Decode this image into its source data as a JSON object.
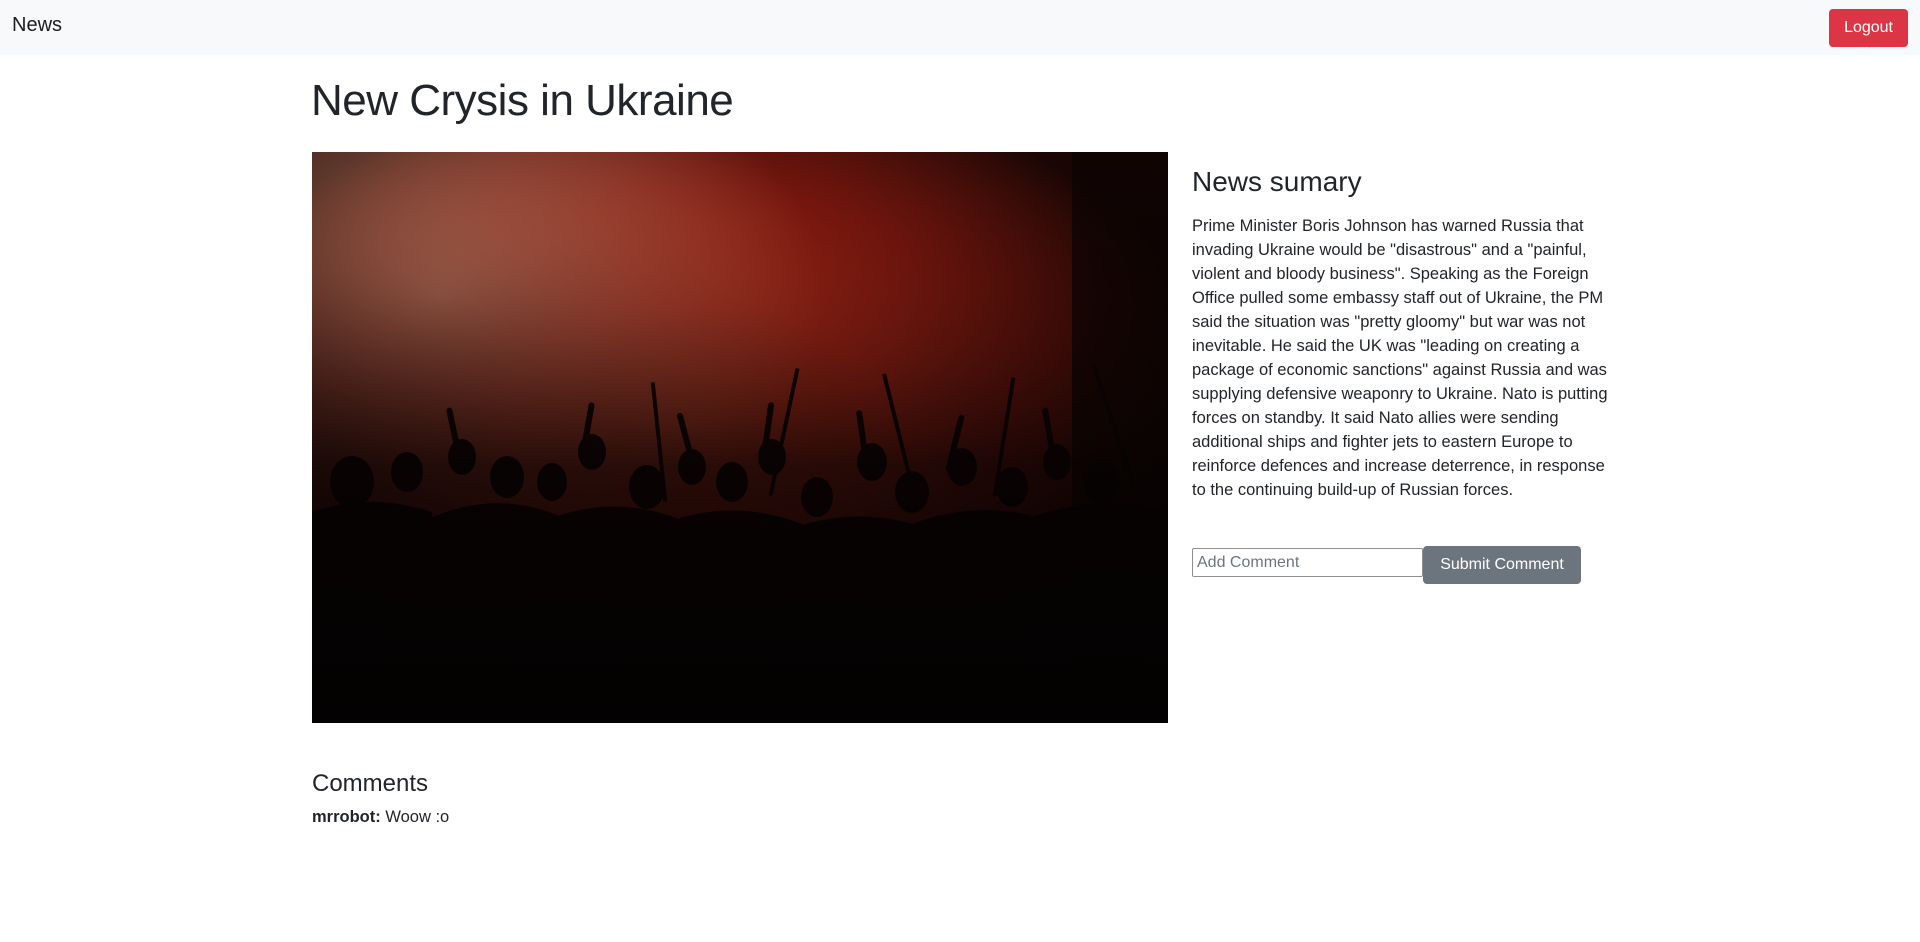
{
  "nav": {
    "brand": "News",
    "logout_label": "Logout"
  },
  "article": {
    "title": "New Crysis in Ukraine",
    "image_alt": "Crowd silhouettes against a red fiery haze",
    "summary_heading": "News sumary",
    "summary_text": "Prime Minister Boris Johnson has warned Russia that invading Ukraine would be \"disastrous\" and a \"painful, violent and bloody business\". Speaking as the Foreign Office pulled some embassy staff out of Ukraine, the PM said the situation was \"pretty gloomy\" but war was not inevitable. He said the UK was \"leading on creating a package of economic sanctions\" against Russia and was supplying defensive weaponry to Ukraine. Nato is putting forces on standby. It said Nato allies were sending additional ships and fighter jets to eastern Europe to reinforce defences and increase deterrence, in response to the continuing build-up of Russian forces."
  },
  "comment_form": {
    "placeholder": "Add Comment",
    "value": "",
    "submit_label": "Submit Comment"
  },
  "comments": {
    "heading": "Comments",
    "items": [
      {
        "author": "mrrobot:",
        "text": "Woow :o"
      }
    ]
  },
  "colors": {
    "navbar_bg": "#f8f9fa",
    "danger": "#dc3545",
    "secondary": "#6c757d",
    "text": "#212529"
  }
}
